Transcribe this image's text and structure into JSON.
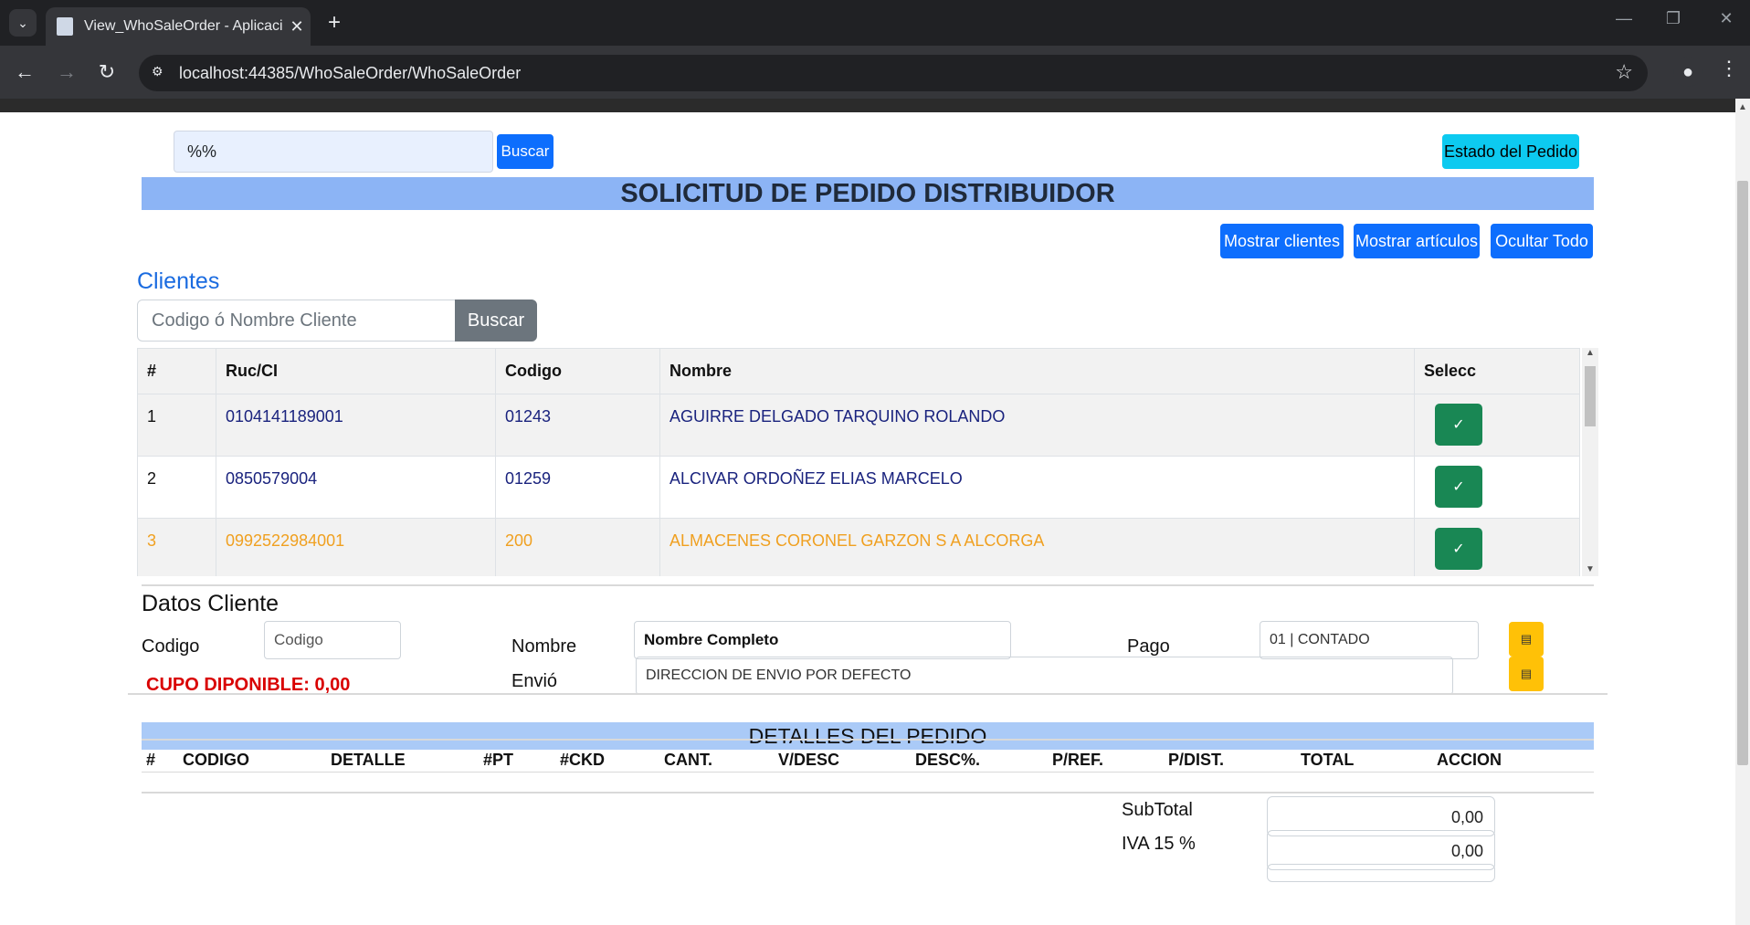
{
  "browser": {
    "tab_title": "View_WhoSaleOrder - Aplicació",
    "url": "localhost:44385/WhoSaleOrder/WhoSaleOrder"
  },
  "top": {
    "search_value": "%%",
    "search_button": "Buscar",
    "estado_button": "Estado del Pedido"
  },
  "header": {
    "title": "SOLICITUD DE PEDIDO DISTRIBUIDOR",
    "mostrar_clientes": "Mostrar clientes",
    "mostrar_articulos": "Mostrar artículos",
    "ocultar_todo": "Ocultar Todo"
  },
  "clientes": {
    "title": "Clientes",
    "search_placeholder": "Codigo ó Nombre Cliente",
    "search_button": "Buscar",
    "columns": [
      "#",
      "Ruc/CI",
      "Codigo",
      "Nombre",
      "Selecc"
    ],
    "rows": [
      {
        "n": "1",
        "ruc": "0104141189001",
        "codigo": "01243",
        "nombre": "AGUIRRE DELGADO TARQUINO ROLANDO"
      },
      {
        "n": "2",
        "ruc": "0850579004",
        "codigo": "01259",
        "nombre": "ALCIVAR ORDOÑEZ ELIAS MARCELO"
      },
      {
        "n": "3",
        "ruc": "0992522984001",
        "codigo": "200",
        "nombre": "ALMACENES CORONEL GARZON S A ALCORGA"
      }
    ]
  },
  "datos_cliente": {
    "title": "Datos Cliente",
    "codigo_label": "Codigo",
    "codigo_placeholder": "Codigo",
    "nombre_label": "Nombre",
    "nombre_value": "Nombre Completo",
    "pago_label": "Pago",
    "pago_value": "01 | CONTADO",
    "cupo": "CUPO DIPONIBLE: 0,00",
    "envio_label": "Envió",
    "envio_value": "DIRECCION DE ENVIO POR DEFECTO"
  },
  "detalles": {
    "title": "DETALLES DEL PEDIDO",
    "columns": [
      "#",
      "CODIGO",
      "DETALLE",
      "#PT",
      "#CKD",
      "CANT.",
      "V/DESC",
      "DESC%.",
      "P/REF.",
      "P/DIST.",
      "TOTAL",
      "ACCION"
    ]
  },
  "totales": {
    "subtotal_label": "SubTotal",
    "subtotal_value": "0,00",
    "iva_label": "IVA 15 %",
    "iva_value": "0,00"
  },
  "colors": {
    "primary": "#0d6efd",
    "info": "#0dcaf0",
    "success": "#198754",
    "warning": "#ffc107",
    "danger": "#d90000",
    "banner": "#8cb4f5"
  }
}
